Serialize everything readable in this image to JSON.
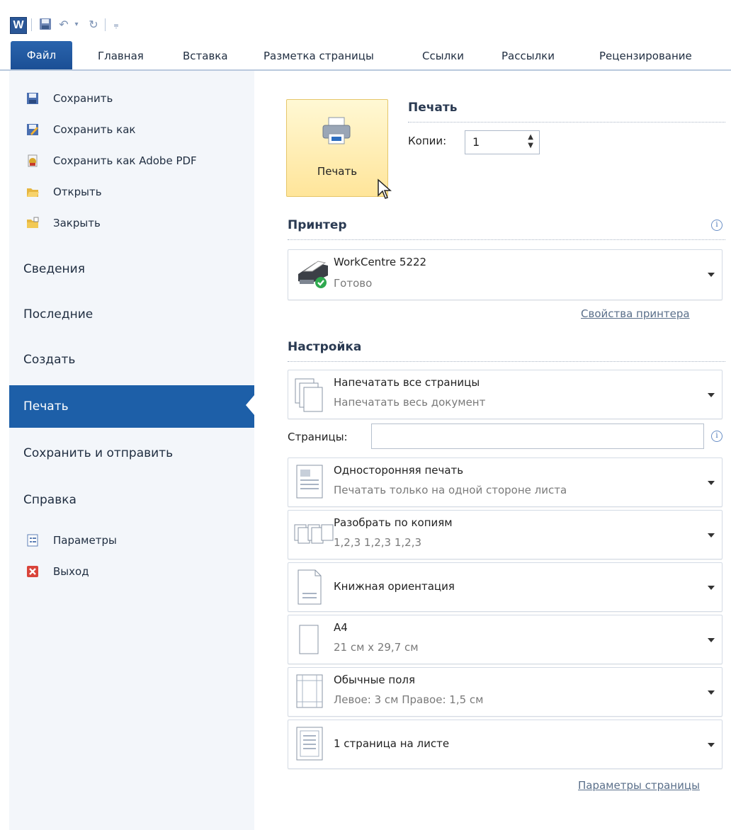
{
  "app": {
    "logo_letter": "W"
  },
  "tabs": [
    "Файл",
    "Главная",
    "Вставка",
    "Разметка страницы",
    "Ссылки",
    "Рассылки",
    "Рецензирование"
  ],
  "sidebar": {
    "commands": [
      {
        "label": "Сохранить",
        "icon": "save-icon"
      },
      {
        "label": "Сохранить как",
        "icon": "save-as-icon"
      },
      {
        "label": "Сохранить как Adobe PDF",
        "icon": "pdf-icon"
      },
      {
        "label": "Открыть",
        "icon": "open-folder-icon"
      },
      {
        "label": "Закрыть",
        "icon": "close-folder-icon"
      }
    ],
    "sections": [
      "Сведения",
      "Последние",
      "Создать",
      "Печать",
      "Сохранить и отправить",
      "Справка"
    ],
    "active_section": "Печать",
    "bottom_commands": [
      {
        "label": "Параметры",
        "icon": "options-icon"
      },
      {
        "label": "Выход",
        "icon": "exit-icon"
      }
    ]
  },
  "print": {
    "button_label": "Печать",
    "section_title": "Печать",
    "copies_label": "Копии:",
    "copies_value": "1"
  },
  "printer": {
    "section_title": "Принтер",
    "name": "WorkCentre 5222",
    "status": "Готово",
    "properties_link": "Свойства принтера"
  },
  "settings": {
    "section_title": "Настройка",
    "pages_label": "Страницы:",
    "pages_value": "",
    "options": [
      {
        "title": "Напечатать все страницы",
        "subtitle": "Напечатать весь документ"
      },
      {
        "title": "Односторонняя печать",
        "subtitle": "Печатать только на одной стороне листа"
      },
      {
        "title": "Разобрать по копиям",
        "subtitle": "1,2,3   1,2,3   1,2,3"
      },
      {
        "title": "Книжная ориентация",
        "subtitle": ""
      },
      {
        "title": "A4",
        "subtitle": "21 см x 29,7 см"
      },
      {
        "title": "Обычные поля",
        "subtitle": "Левое: 3 см   Правое: 1,5 см"
      },
      {
        "title": "1 страница на листе",
        "subtitle": ""
      }
    ],
    "page_setup_link": "Параметры страницы"
  },
  "colors": {
    "accent": "#1d5fa8",
    "sidebar_bg": "#f3f6fa",
    "print_button": "#ffe59a"
  }
}
